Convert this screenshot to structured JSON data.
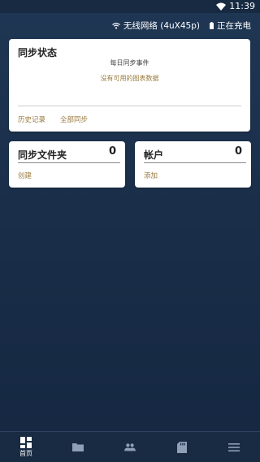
{
  "status_bar": {
    "time": "11:39"
  },
  "device_info": {
    "wifi": "无线网络 (4uX45p)",
    "charging": "正在充电"
  },
  "sync_status": {
    "title": "同步状态",
    "daily_events": "每日同步事件",
    "no_data": "没有可用的图表数据",
    "history": "历史记录",
    "sync_all": "全部同步"
  },
  "folders": {
    "title": "同步文件夹",
    "count": "0",
    "action": "创建"
  },
  "account": {
    "title": "帐户",
    "count": "0",
    "action": "添加"
  },
  "nav": {
    "home_label": "首页",
    "items": [
      "home-icon",
      "folder-icon",
      "people-icon",
      "sd-card-icon",
      "menu-icon"
    ]
  }
}
